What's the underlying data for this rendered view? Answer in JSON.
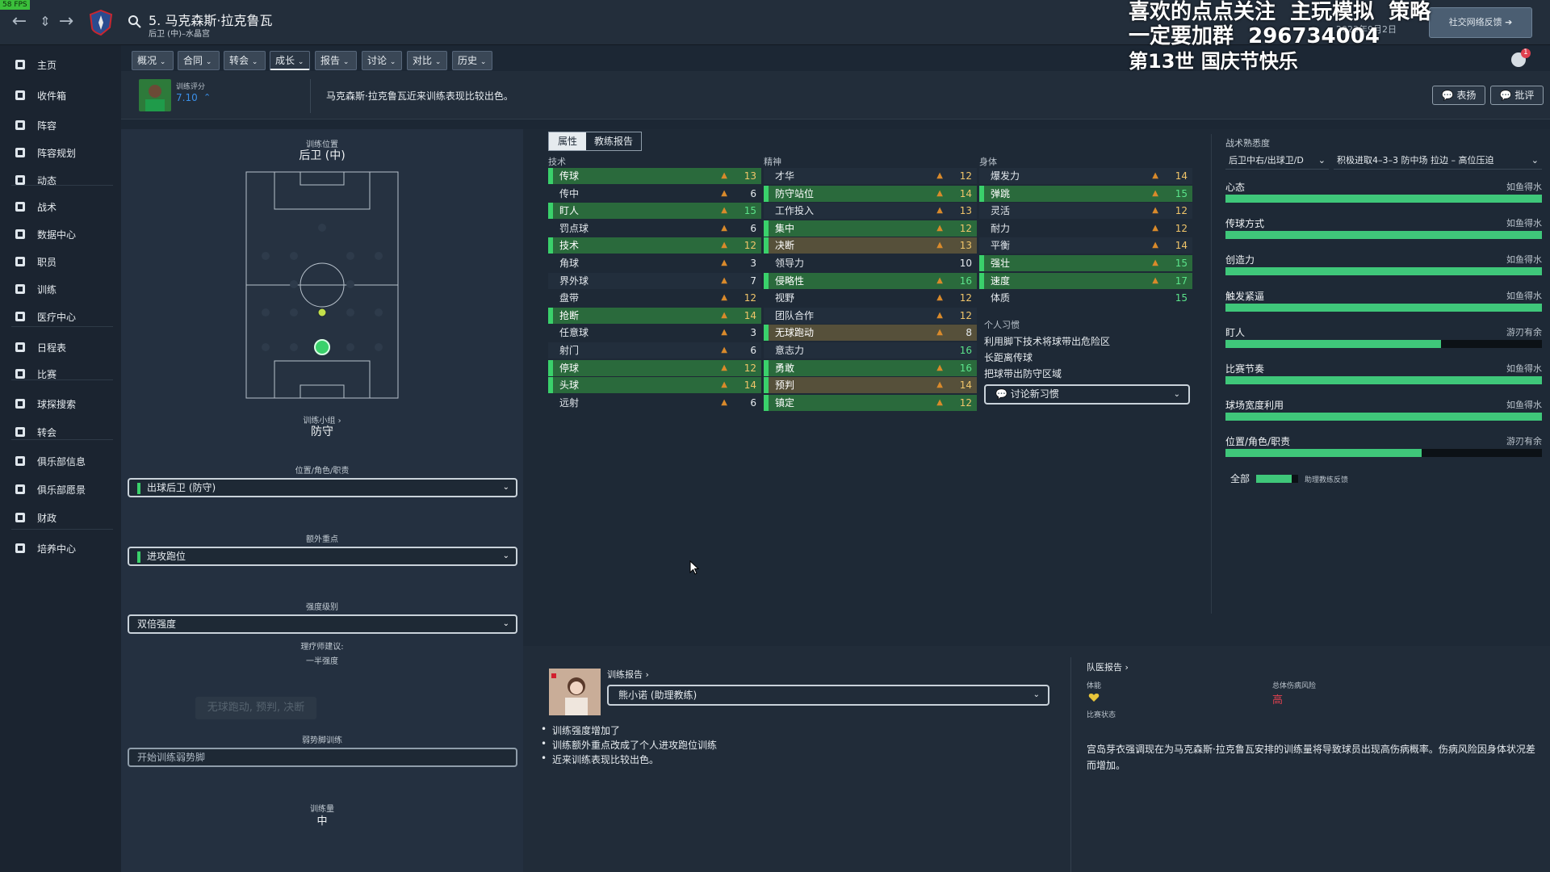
{
  "fps": "58 FPS",
  "header": {
    "title": "5. 马克森斯·拉克鲁瓦",
    "subtitle": "后卫 (中)–水晶宫",
    "date": "2023年9月2日",
    "social_btn": "社交网络反馈",
    "overlay_line1": "喜欢的点点关注  主玩模拟  策略",
    "overlay_line2": "一定要加群  296734004",
    "overlay_line3": "第13世    国庆节快乐",
    "notif_count": "1"
  },
  "sidebar": {
    "items": [
      {
        "label": "主页",
        "icon": "home-icon"
      },
      {
        "label": "收件箱",
        "icon": "inbox-icon"
      },
      {
        "label": "阵容",
        "icon": "shirt-icon"
      },
      {
        "label": "阵容规划",
        "icon": "clipboard-icon"
      },
      {
        "label": "动态",
        "icon": "dynamics-icon"
      },
      {
        "label": "战术",
        "icon": "tactics-icon"
      },
      {
        "label": "数据中心",
        "icon": "data-icon"
      },
      {
        "label": "职员",
        "icon": "staff-icon"
      },
      {
        "label": "训练",
        "icon": "training-icon"
      },
      {
        "label": "医疗中心",
        "icon": "medical-icon"
      },
      {
        "label": "日程表",
        "icon": "calendar-icon"
      },
      {
        "label": "比赛",
        "icon": "trophy-icon"
      },
      {
        "label": "球探搜索",
        "icon": "scout-icon"
      },
      {
        "label": "转会",
        "icon": "transfer-icon"
      },
      {
        "label": "俱乐部信息",
        "icon": "shield-icon"
      },
      {
        "label": "俱乐部愿景",
        "icon": "vision-icon"
      },
      {
        "label": "财政",
        "icon": "finance-icon"
      },
      {
        "label": "培养中心",
        "icon": "development-icon"
      }
    ]
  },
  "tabs": [
    "概况",
    "合同",
    "转会",
    "成长",
    "报告",
    "讨论",
    "对比",
    "历史"
  ],
  "message": {
    "rating_label": "训练评分",
    "rating_value": "7.10",
    "text": "马克森斯·拉克鲁瓦近来训练表现比较出色。",
    "praise": "表扬",
    "criticize": "批评"
  },
  "left": {
    "pos_label": "训练位置",
    "pos_value": "后卫 (中)",
    "group_label": "训练小组 ›",
    "group_value": "防守",
    "role_label": "位置/角色/职责",
    "role_value": "出球后卫 (防守)",
    "extra_label": "额外重点",
    "extra_value": "进攻跑位",
    "intensity_label": "强度级别",
    "intensity_value": "双倍强度",
    "physio_label": "理疗师建议:",
    "physio_value": "一半强度",
    "ghost_text": "无球跑动, 预判, 决断",
    "weakfoot_label": "弱势脚训练",
    "weakfoot_value": "开始训练弱势脚",
    "volume_label": "训练量",
    "volume_value": "中"
  },
  "attr_tabs": {
    "attributes": "属性",
    "coach_report": "教练报告"
  },
  "technical": {
    "title": "技术",
    "items": [
      {
        "name": "传球",
        "value": "13",
        "hl": "green"
      },
      {
        "name": "传中",
        "value": "6",
        "hl": ""
      },
      {
        "name": "盯人",
        "value": "15",
        "hl": "green"
      },
      {
        "name": "罚点球",
        "value": "6",
        "hl": ""
      },
      {
        "name": "技术",
        "value": "12",
        "hl": "green"
      },
      {
        "name": "角球",
        "value": "3",
        "hl": ""
      },
      {
        "name": "界外球",
        "value": "7",
        "hl": ""
      },
      {
        "name": "盘带",
        "value": "12",
        "hl": ""
      },
      {
        "name": "抢断",
        "value": "14",
        "hl": "green"
      },
      {
        "name": "任意球",
        "value": "3",
        "hl": ""
      },
      {
        "name": "射门",
        "value": "6",
        "hl": ""
      },
      {
        "name": "停球",
        "value": "12",
        "hl": "green"
      },
      {
        "name": "头球",
        "value": "14",
        "hl": "green"
      },
      {
        "name": "远射",
        "value": "6",
        "hl": ""
      }
    ]
  },
  "mental": {
    "title": "精神",
    "items": [
      {
        "name": "才华",
        "value": "12",
        "hl": ""
      },
      {
        "name": "防守站位",
        "value": "14",
        "hl": "green"
      },
      {
        "name": "工作投入",
        "value": "13",
        "hl": ""
      },
      {
        "name": "集中",
        "value": "12",
        "hl": "green"
      },
      {
        "name": "决断",
        "value": "13",
        "hl": "olive"
      },
      {
        "name": "领导力",
        "value": "10",
        "hl": ""
      },
      {
        "name": "侵略性",
        "value": "16",
        "hl": "green"
      },
      {
        "name": "视野",
        "value": "12",
        "hl": ""
      },
      {
        "name": "团队合作",
        "value": "12",
        "hl": ""
      },
      {
        "name": "无球跑动",
        "value": "8",
        "hl": "olive"
      },
      {
        "name": "意志力",
        "value": "16",
        "hl": ""
      },
      {
        "name": "勇敢",
        "value": "16",
        "hl": "green"
      },
      {
        "name": "预判",
        "value": "14",
        "hl": "olive"
      },
      {
        "name": "镇定",
        "value": "12",
        "hl": "green"
      }
    ]
  },
  "physical": {
    "title": "身体",
    "items": [
      {
        "name": "爆发力",
        "value": "14",
        "hl": ""
      },
      {
        "name": "弹跳",
        "value": "15",
        "hl": "green"
      },
      {
        "name": "灵活",
        "value": "12",
        "hl": ""
      },
      {
        "name": "耐力",
        "value": "12",
        "hl": ""
      },
      {
        "name": "平衡",
        "value": "14",
        "hl": ""
      },
      {
        "name": "强壮",
        "value": "15",
        "hl": "green"
      },
      {
        "name": "速度",
        "value": "17",
        "hl": "green"
      },
      {
        "name": "体质",
        "value": "15",
        "hl": ""
      }
    ]
  },
  "habits": {
    "title": "个人习惯",
    "items": [
      "利用脚下技术将球带出危险区",
      "长距离传球",
      "把球带出防守区域"
    ],
    "discuss_btn": "讨论新习惯"
  },
  "tactical": {
    "title": "战术熟悉度",
    "role_dd": "后卫中右/出球卫/D",
    "tactic_dd": "积极进取4–3–3 防中场 拉边 – 高位压迫",
    "rows": [
      {
        "name": "心态",
        "status": "如鱼得水",
        "fill": 1.0
      },
      {
        "name": "传球方式",
        "status": "如鱼得水",
        "fill": 1.0
      },
      {
        "name": "创造力",
        "status": "如鱼得水",
        "fill": 1.0
      },
      {
        "name": "触发紧逼",
        "status": "如鱼得水",
        "fill": 1.0
      },
      {
        "name": "盯人",
        "status": "游刃有余",
        "fill": 0.68
      },
      {
        "name": "比赛节奏",
        "status": "如鱼得水",
        "fill": 1.0
      },
      {
        "name": "球场宽度利用",
        "status": "如鱼得水",
        "fill": 1.0
      },
      {
        "name": "位置/角色/职责",
        "status": "游刃有余",
        "fill": 0.62
      }
    ],
    "all_label": "全部",
    "assistant_label": "助理教练反馈"
  },
  "report": {
    "title": "训练报告 ›",
    "coach": "熊小诺 (助理教练)",
    "bullets": [
      "训练强度增加了",
      "训练额外重点改成了个人进攻跑位训练",
      "近来训练表现比较出色。"
    ]
  },
  "medical": {
    "title": "队医报告 ›",
    "fitness_label": "体能",
    "match_label": "比赛状态",
    "risk_label": "总体伤病风险",
    "risk_value": "高",
    "text": "宫岛芽衣强调现在为马克森斯·拉克鲁瓦安排的训练量将导致球员出现高伤病概率。伤病风险因身体状况差而增加。"
  },
  "colors": {
    "accent_green": "#3ad16b",
    "risk_red": "#e0414f",
    "arrow_orange": "#d98a2b"
  }
}
